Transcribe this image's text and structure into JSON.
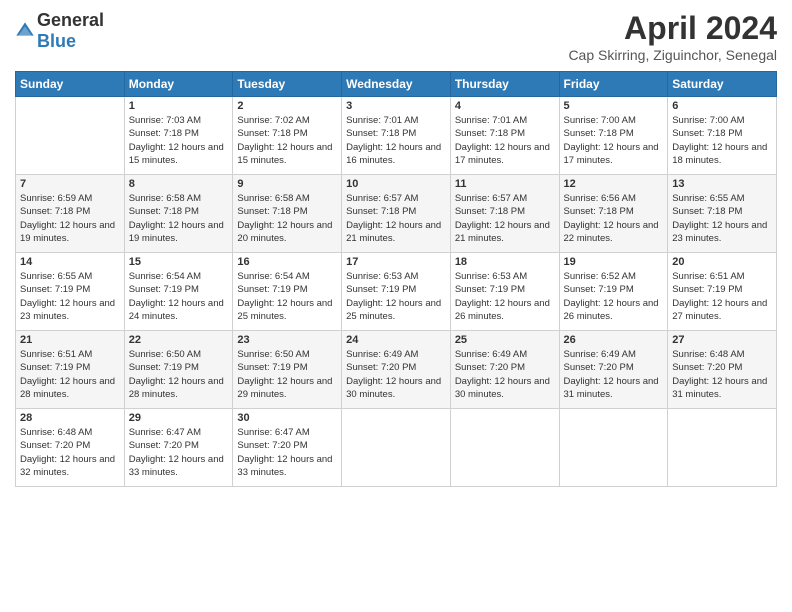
{
  "logo": {
    "general": "General",
    "blue": "Blue"
  },
  "header": {
    "title": "April 2024",
    "subtitle": "Cap Skirring, Ziguinchor, Senegal"
  },
  "days_of_week": [
    "Sunday",
    "Monday",
    "Tuesday",
    "Wednesday",
    "Thursday",
    "Friday",
    "Saturday"
  ],
  "weeks": [
    [
      {
        "day": "",
        "sunrise": "",
        "sunset": "",
        "daylight": ""
      },
      {
        "day": "1",
        "sunrise": "Sunrise: 7:03 AM",
        "sunset": "Sunset: 7:18 PM",
        "daylight": "Daylight: 12 hours and 15 minutes."
      },
      {
        "day": "2",
        "sunrise": "Sunrise: 7:02 AM",
        "sunset": "Sunset: 7:18 PM",
        "daylight": "Daylight: 12 hours and 15 minutes."
      },
      {
        "day": "3",
        "sunrise": "Sunrise: 7:01 AM",
        "sunset": "Sunset: 7:18 PM",
        "daylight": "Daylight: 12 hours and 16 minutes."
      },
      {
        "day": "4",
        "sunrise": "Sunrise: 7:01 AM",
        "sunset": "Sunset: 7:18 PM",
        "daylight": "Daylight: 12 hours and 17 minutes."
      },
      {
        "day": "5",
        "sunrise": "Sunrise: 7:00 AM",
        "sunset": "Sunset: 7:18 PM",
        "daylight": "Daylight: 12 hours and 17 minutes."
      },
      {
        "day": "6",
        "sunrise": "Sunrise: 7:00 AM",
        "sunset": "Sunset: 7:18 PM",
        "daylight": "Daylight: 12 hours and 18 minutes."
      }
    ],
    [
      {
        "day": "7",
        "sunrise": "Sunrise: 6:59 AM",
        "sunset": "Sunset: 7:18 PM",
        "daylight": "Daylight: 12 hours and 19 minutes."
      },
      {
        "day": "8",
        "sunrise": "Sunrise: 6:58 AM",
        "sunset": "Sunset: 7:18 PM",
        "daylight": "Daylight: 12 hours and 19 minutes."
      },
      {
        "day": "9",
        "sunrise": "Sunrise: 6:58 AM",
        "sunset": "Sunset: 7:18 PM",
        "daylight": "Daylight: 12 hours and 20 minutes."
      },
      {
        "day": "10",
        "sunrise": "Sunrise: 6:57 AM",
        "sunset": "Sunset: 7:18 PM",
        "daylight": "Daylight: 12 hours and 21 minutes."
      },
      {
        "day": "11",
        "sunrise": "Sunrise: 6:57 AM",
        "sunset": "Sunset: 7:18 PM",
        "daylight": "Daylight: 12 hours and 21 minutes."
      },
      {
        "day": "12",
        "sunrise": "Sunrise: 6:56 AM",
        "sunset": "Sunset: 7:18 PM",
        "daylight": "Daylight: 12 hours and 22 minutes."
      },
      {
        "day": "13",
        "sunrise": "Sunrise: 6:55 AM",
        "sunset": "Sunset: 7:18 PM",
        "daylight": "Daylight: 12 hours and 23 minutes."
      }
    ],
    [
      {
        "day": "14",
        "sunrise": "Sunrise: 6:55 AM",
        "sunset": "Sunset: 7:19 PM",
        "daylight": "Daylight: 12 hours and 23 minutes."
      },
      {
        "day": "15",
        "sunrise": "Sunrise: 6:54 AM",
        "sunset": "Sunset: 7:19 PM",
        "daylight": "Daylight: 12 hours and 24 minutes."
      },
      {
        "day": "16",
        "sunrise": "Sunrise: 6:54 AM",
        "sunset": "Sunset: 7:19 PM",
        "daylight": "Daylight: 12 hours and 25 minutes."
      },
      {
        "day": "17",
        "sunrise": "Sunrise: 6:53 AM",
        "sunset": "Sunset: 7:19 PM",
        "daylight": "Daylight: 12 hours and 25 minutes."
      },
      {
        "day": "18",
        "sunrise": "Sunrise: 6:53 AM",
        "sunset": "Sunset: 7:19 PM",
        "daylight": "Daylight: 12 hours and 26 minutes."
      },
      {
        "day": "19",
        "sunrise": "Sunrise: 6:52 AM",
        "sunset": "Sunset: 7:19 PM",
        "daylight": "Daylight: 12 hours and 26 minutes."
      },
      {
        "day": "20",
        "sunrise": "Sunrise: 6:51 AM",
        "sunset": "Sunset: 7:19 PM",
        "daylight": "Daylight: 12 hours and 27 minutes."
      }
    ],
    [
      {
        "day": "21",
        "sunrise": "Sunrise: 6:51 AM",
        "sunset": "Sunset: 7:19 PM",
        "daylight": "Daylight: 12 hours and 28 minutes."
      },
      {
        "day": "22",
        "sunrise": "Sunrise: 6:50 AM",
        "sunset": "Sunset: 7:19 PM",
        "daylight": "Daylight: 12 hours and 28 minutes."
      },
      {
        "day": "23",
        "sunrise": "Sunrise: 6:50 AM",
        "sunset": "Sunset: 7:19 PM",
        "daylight": "Daylight: 12 hours and 29 minutes."
      },
      {
        "day": "24",
        "sunrise": "Sunrise: 6:49 AM",
        "sunset": "Sunset: 7:20 PM",
        "daylight": "Daylight: 12 hours and 30 minutes."
      },
      {
        "day": "25",
        "sunrise": "Sunrise: 6:49 AM",
        "sunset": "Sunset: 7:20 PM",
        "daylight": "Daylight: 12 hours and 30 minutes."
      },
      {
        "day": "26",
        "sunrise": "Sunrise: 6:49 AM",
        "sunset": "Sunset: 7:20 PM",
        "daylight": "Daylight: 12 hours and 31 minutes."
      },
      {
        "day": "27",
        "sunrise": "Sunrise: 6:48 AM",
        "sunset": "Sunset: 7:20 PM",
        "daylight": "Daylight: 12 hours and 31 minutes."
      }
    ],
    [
      {
        "day": "28",
        "sunrise": "Sunrise: 6:48 AM",
        "sunset": "Sunset: 7:20 PM",
        "daylight": "Daylight: 12 hours and 32 minutes."
      },
      {
        "day": "29",
        "sunrise": "Sunrise: 6:47 AM",
        "sunset": "Sunset: 7:20 PM",
        "daylight": "Daylight: 12 hours and 33 minutes."
      },
      {
        "day": "30",
        "sunrise": "Sunrise: 6:47 AM",
        "sunset": "Sunset: 7:20 PM",
        "daylight": "Daylight: 12 hours and 33 minutes."
      },
      {
        "day": "",
        "sunrise": "",
        "sunset": "",
        "daylight": ""
      },
      {
        "day": "",
        "sunrise": "",
        "sunset": "",
        "daylight": ""
      },
      {
        "day": "",
        "sunrise": "",
        "sunset": "",
        "daylight": ""
      },
      {
        "day": "",
        "sunrise": "",
        "sunset": "",
        "daylight": ""
      }
    ]
  ]
}
